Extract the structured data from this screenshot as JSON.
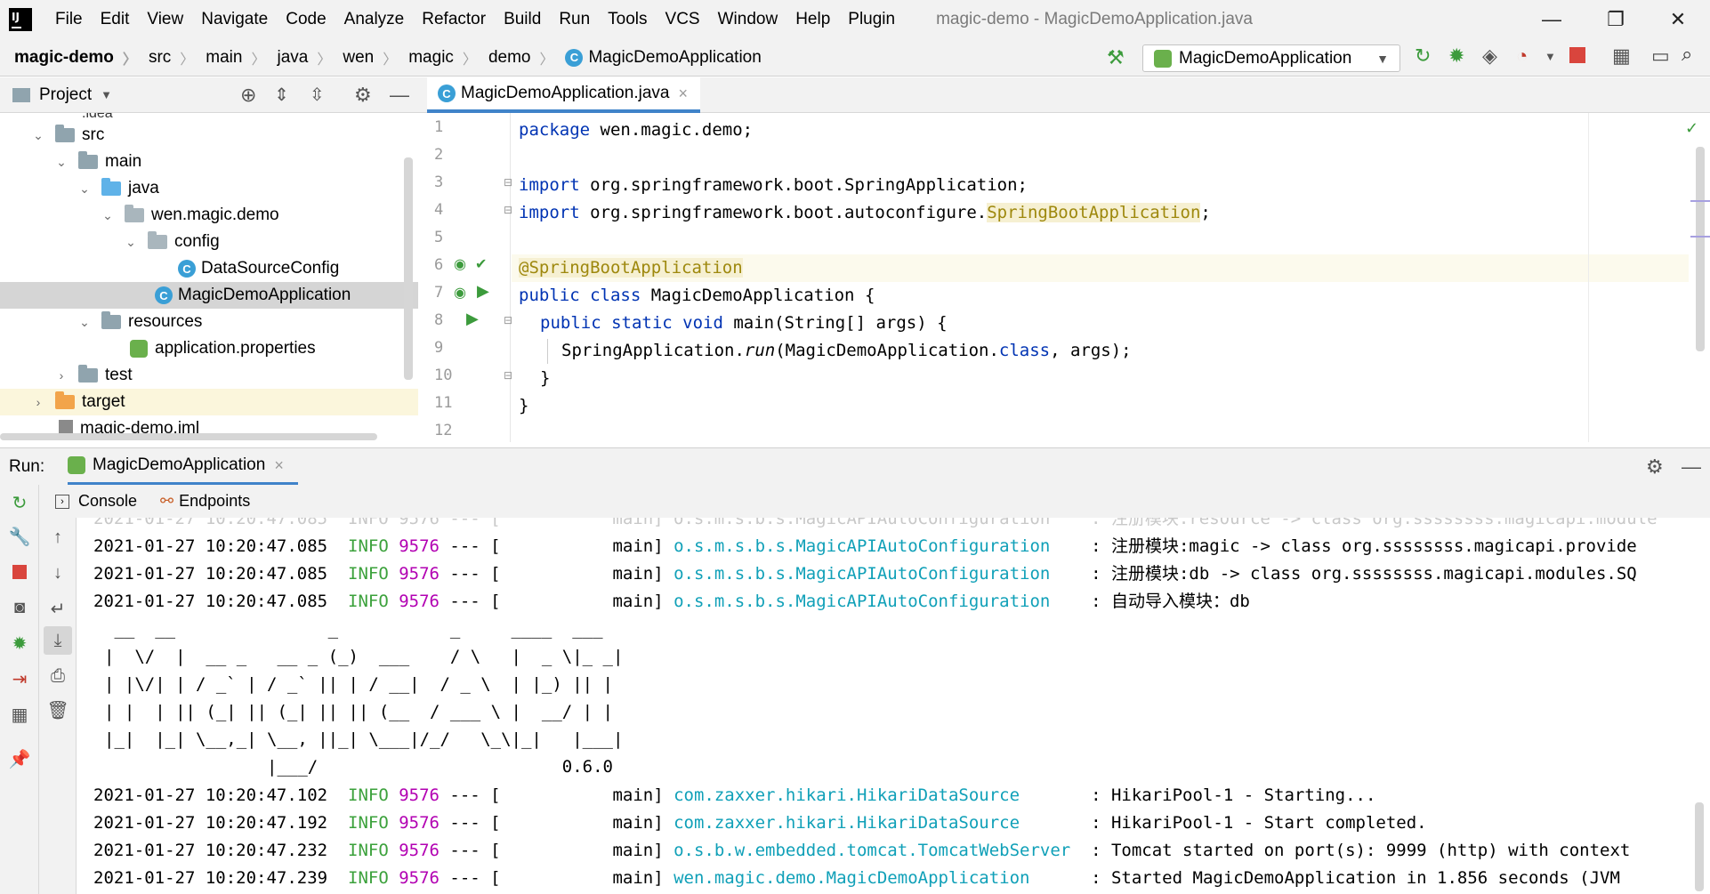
{
  "menubar": {
    "items": [
      "File",
      "Edit",
      "View",
      "Navigate",
      "Code",
      "Analyze",
      "Refactor",
      "Build",
      "Run",
      "Tools",
      "VCS",
      "Window",
      "Help",
      "Plugin"
    ],
    "window_title": "magic-demo - MagicDemoApplication.java",
    "minimize": "—",
    "restore": "❐",
    "close": "✕"
  },
  "breadcrumb": [
    "magic-demo",
    "src",
    "main",
    "java",
    "wen",
    "magic",
    "demo",
    "MagicDemoApplication"
  ],
  "toolbar": {
    "run_config": "MagicDemoApplication"
  },
  "project_panel": {
    "title": "Project",
    "tree": [
      {
        "label": "src",
        "indent": 1,
        "arrow": "down",
        "icon": "folder"
      },
      {
        "label": "main",
        "indent": 2,
        "arrow": "down",
        "icon": "folder"
      },
      {
        "label": "java",
        "indent": 3,
        "arrow": "down",
        "icon": "folder-blue"
      },
      {
        "label": "wen.magic.demo",
        "indent": 4,
        "arrow": "down",
        "icon": "package"
      },
      {
        "label": "config",
        "indent": 5,
        "arrow": "down",
        "icon": "package"
      },
      {
        "label": "DataSourceConfig",
        "indent": 6,
        "arrow": "",
        "icon": "class"
      },
      {
        "label": "MagicDemoApplication",
        "indent": 5,
        "arrow": "",
        "icon": "class",
        "selected": true
      },
      {
        "label": "resources",
        "indent": 3,
        "arrow": "down",
        "icon": "folder"
      },
      {
        "label": "application.properties",
        "indent": 4,
        "arrow": "",
        "icon": "properties"
      },
      {
        "label": "test",
        "indent": 2,
        "arrow": "right",
        "icon": "folder"
      },
      {
        "label": "target",
        "indent": 1,
        "arrow": "right",
        "icon": "folder-orange",
        "excluded": true
      },
      {
        "label": "magic-demo.iml",
        "indent": 1,
        "arrow": "",
        "icon": "file"
      }
    ]
  },
  "editor": {
    "tab_label": "MagicDemoApplication.java",
    "tab_close": "×",
    "line_numbers": [
      "1",
      "2",
      "3",
      "4",
      "5",
      "6",
      "7",
      "8",
      "9",
      "10",
      "11",
      "12"
    ],
    "lines": {
      "l1_kw": "package",
      "l1_rest": " wen.magic.demo;",
      "l3_kw": "import",
      "l3_rest": " org.springframework.boot.SpringApplication;",
      "l4_kw": "import",
      "l4_rest": " org.springframework.boot.autoconfigure.",
      "l4_ann": "SpringBootApplication",
      "l4_end": ";",
      "l6_ann": "@SpringBootApplication",
      "l7_kw": "public class",
      "l7_rest": " MagicDemoApplication {",
      "l8_kw": "public static void",
      "l8_rest": " main(String[] args) {",
      "l9_a": "SpringApplication.",
      "l9_run": "run",
      "l9_b": "(MagicDemoApplication.",
      "l9_class": "class",
      "l9_c": ", args);",
      "l10": "}",
      "l11": "}"
    }
  },
  "run_panel": {
    "label": "Run:",
    "tab_label": "MagicDemoApplication",
    "tab_close": "×",
    "console_tab": "Console",
    "endpoints_tab": "Endpoints"
  },
  "console": {
    "logs_top": [
      {
        "ts": "2021-01-27 10:20:47.085",
        "level": "INFO",
        "pid": "9576",
        "sep": " --- [",
        "thread": "           main] ",
        "logger": "o.s.m.s.b.s.MagicAPIAutoConfiguration",
        "pad": "    ",
        "msg": ": 注册模块:magic -> class org.ssssssss.magicapi.provide"
      },
      {
        "ts": "2021-01-27 10:20:47.085",
        "level": "INFO",
        "pid": "9576",
        "sep": " --- [",
        "thread": "           main] ",
        "logger": "o.s.m.s.b.s.MagicAPIAutoConfiguration",
        "pad": "    ",
        "msg": ": 注册模块:db -> class org.ssssssss.magicapi.modules.SQ"
      },
      {
        "ts": "2021-01-27 10:20:47.085",
        "level": "INFO",
        "pid": "9576",
        "sep": " --- [",
        "thread": "           main] ",
        "logger": "o.s.m.s.b.s.MagicAPIAutoConfiguration",
        "pad": "    ",
        "msg": ": 自动导入模块：db"
      }
    ],
    "banner": [
      " __  __               _           _     ____  ___ ",
      "|  \\/  |  __ _   __ _ (_)  ___    / \\   |  _ \\|_ _|",
      "| |\\/| | / _` | / _` || | / __|  / _ \\  | |_) || | ",
      "| |  | || (_| || (_| || || (__  / ___ \\ |  __/ | | ",
      "|_|  |_| \\__,_| \\__, ||_| \\___|/_/   \\_\\|_|   |___|",
      "                |___/                        0.6.0"
    ],
    "logs_bottom": [
      {
        "ts": "2021-01-27 10:20:47.102",
        "level": "INFO",
        "pid": "9576",
        "sep": " --- [",
        "thread": "           main] ",
        "logger": "com.zaxxer.hikari.HikariDataSource",
        "pad": "       ",
        "msg": ": HikariPool-1 - Starting..."
      },
      {
        "ts": "2021-01-27 10:20:47.192",
        "level": "INFO",
        "pid": "9576",
        "sep": " --- [",
        "thread": "           main] ",
        "logger": "com.zaxxer.hikari.HikariDataSource",
        "pad": "       ",
        "msg": ": HikariPool-1 - Start completed."
      },
      {
        "ts": "2021-01-27 10:20:47.232",
        "level": "INFO",
        "pid": "9576",
        "sep": " --- [",
        "thread": "           main] ",
        "logger": "o.s.b.w.embedded.tomcat.TomcatWebServer",
        "pad": "  ",
        "msg": ": Tomcat started on port(s): 9999 (http) with context"
      },
      {
        "ts": "2021-01-27 10:20:47.239",
        "level": "INFO",
        "pid": "9576",
        "sep": " --- [",
        "thread": "           main] ",
        "logger": "wen.magic.demo.MagicDemoApplication",
        "pad": "      ",
        "msg": ": Started MagicDemoApplication in 1.856 seconds (JVM"
      }
    ]
  },
  "colors": {
    "accent": "#4083c9",
    "keyword": "#0033b3",
    "annotation": "#9e880d",
    "log_level": "#3ba13b",
    "pid": "#b200b2",
    "logger": "#10a0b8"
  }
}
